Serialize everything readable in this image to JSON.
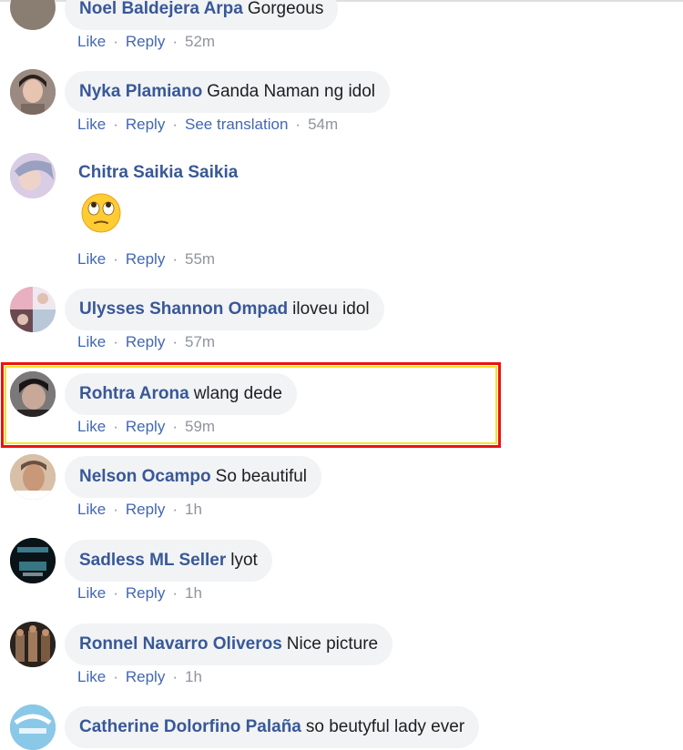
{
  "comments": [
    {
      "author": "Noel Baldejera Arpa",
      "text": "Gorgeous",
      "like": "Like",
      "reply": "Reply",
      "time": "52m",
      "avatar_color": "#8a7d72"
    },
    {
      "author": "Nyka Plamiano",
      "text": "Ganda Naman ng idol",
      "like": "Like",
      "reply": "Reply",
      "see_translation": "See translation",
      "time": "54m",
      "avatar_color": "#6b5a52"
    },
    {
      "author": "Chitra Saikia Saikia",
      "text": "",
      "emoji": "face-with-rolling-eyes",
      "like": "Like",
      "reply": "Reply",
      "time": "55m",
      "avatar_color": "#c9b8d8"
    },
    {
      "author": "Ulysses Shannon Ompad",
      "text": "iloveu idol",
      "like": "Like",
      "reply": "Reply",
      "time": "57m",
      "avatar_color": "#d8a0a8"
    },
    {
      "author": "Rohtra Arona",
      "text": "wlang dede",
      "like": "Like",
      "reply": "Reply",
      "time": "59m",
      "avatar_color": "#4a4040",
      "highlighted": true
    },
    {
      "author": "Nelson Ocampo",
      "text": "So beautiful",
      "like": "Like",
      "reply": "Reply",
      "time": "1h",
      "avatar_color": "#b89a80"
    },
    {
      "author": "Sadless ML Seller",
      "text": "lyot",
      "like": "Like",
      "reply": "Reply",
      "time": "1h",
      "avatar_color": "#12202a"
    },
    {
      "author": "Ronnel Navarro Oliveros",
      "text": "Nice picture",
      "like": "Like",
      "reply": "Reply",
      "time": "1h",
      "avatar_color": "#3a2f28"
    },
    {
      "author": "Catherine Dolorfino Palaña",
      "text": "so beutyful lady ever",
      "avatar_color": "#5aa0c8"
    }
  ],
  "colors": {
    "author": "#385898",
    "link": "#4267b2",
    "bubble": "#f2f3f5",
    "highlight_border": "#ee1111",
    "highlight_inner": "#f7e32a"
  }
}
